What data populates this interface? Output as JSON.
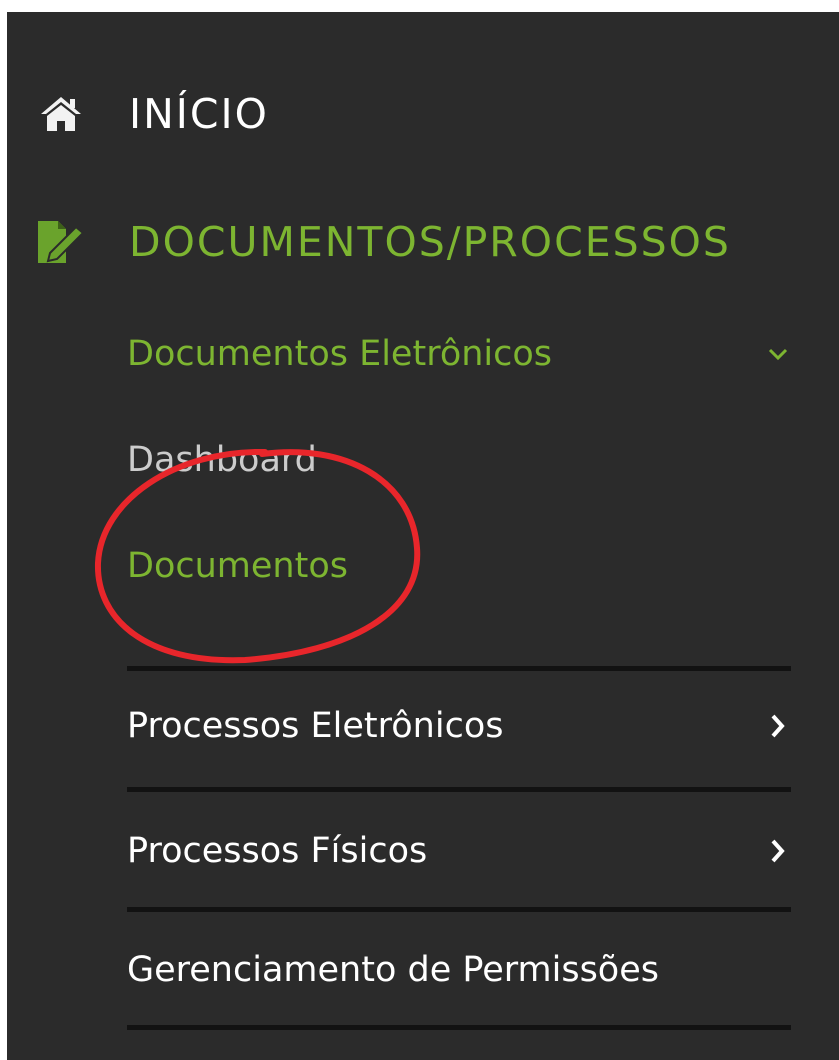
{
  "nav": {
    "home": {
      "label": "INÍCIO",
      "icon": "home-icon"
    },
    "documents_processes": {
      "label": "DOCUMENTOS/PROCESSOS",
      "icon": "edit-document-icon"
    }
  },
  "submenu": {
    "electronic_documents": {
      "label": "Documentos Eletrônicos",
      "icon": "chevron-down-icon"
    },
    "dashboard": {
      "label": "Dashboard"
    },
    "documents": {
      "label": "Documentos"
    },
    "electronic_processes": {
      "label": "Processos Eletrônicos",
      "icon": "chevron-right-icon"
    },
    "physical_processes": {
      "label": "Processos Físicos",
      "icon": "chevron-right-icon"
    },
    "permissions": {
      "label": "Gerenciamento de Permissões"
    }
  },
  "colors": {
    "panel_bg": "#2b2b2b",
    "active_green": "#7db531",
    "annotation_red": "#e8262b"
  }
}
